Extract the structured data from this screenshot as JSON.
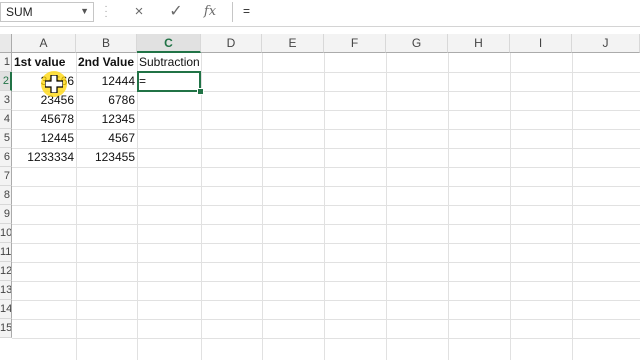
{
  "formula_bar": {
    "name_box": "SUM",
    "cancel_icon": "×",
    "enter_icon": "✓",
    "fx_label": "fx",
    "formula": "="
  },
  "columns": [
    "A",
    "B",
    "C",
    "D",
    "E",
    "F",
    "G",
    "H",
    "I",
    "J"
  ],
  "selected_column": "C",
  "rows": [
    "1",
    "2",
    "3",
    "4",
    "5",
    "6",
    "7",
    "8",
    "9",
    "10",
    "11",
    "12",
    "13",
    "14",
    "15"
  ],
  "selected_row": "2",
  "cells": {
    "A1": "1st value",
    "B1": "2nd Value",
    "C1": "Subtraction",
    "A2": "34566",
    "B2": "12444",
    "C2": "=",
    "A3": "23456",
    "B3": "6786",
    "A4": "45678",
    "B4": "12345",
    "A5": "12445",
    "B5": "4567",
    "A6": "1233334",
    "B6": "123455"
  },
  "colors": {
    "accent": "#217346",
    "highlight": "#ffd600"
  }
}
